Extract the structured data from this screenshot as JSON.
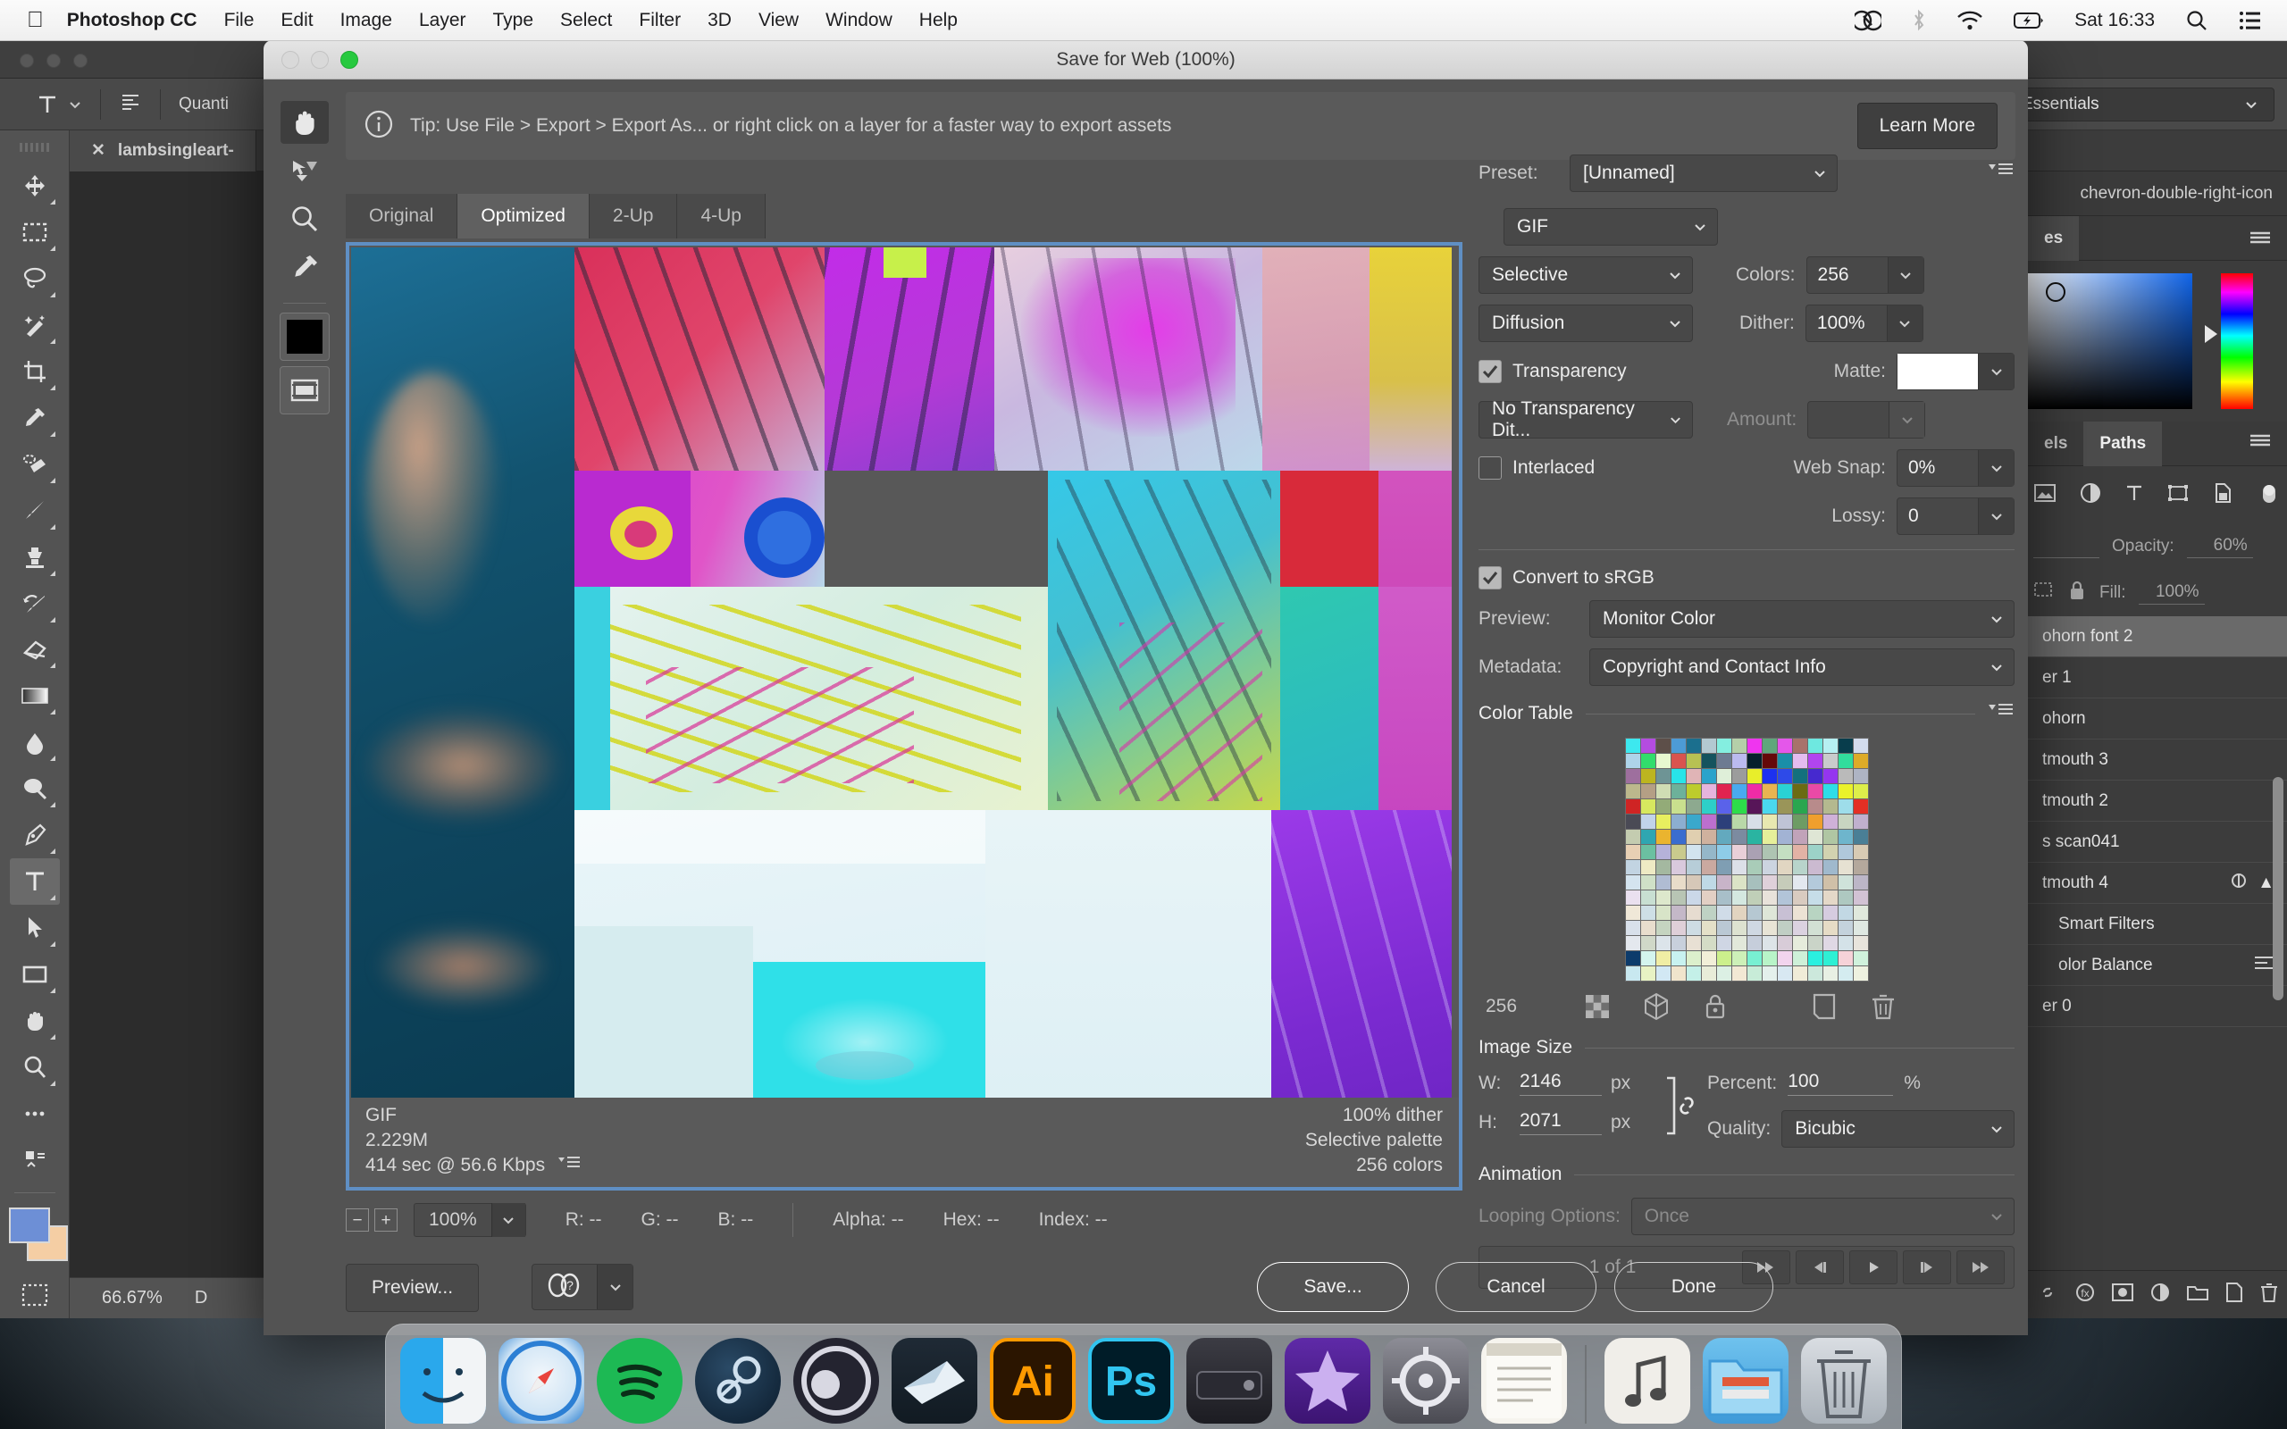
{
  "menubar": {
    "apple_icon": "apple-logo-icon",
    "app_name": "Photoshop CC",
    "items": [
      "File",
      "Edit",
      "Image",
      "Layer",
      "Type",
      "Select",
      "Filter",
      "3D",
      "View",
      "Window",
      "Help"
    ],
    "status_icons": [
      "creative-cloud-icon",
      "bluetooth-icon",
      "wifi-icon",
      "battery-charging-icon"
    ],
    "clock": "Sat 16:33",
    "search_icon": "search-icon",
    "control-center_icon": "control-center-icon"
  },
  "photoshop": {
    "options_bar": {
      "tool_label": "T",
      "paragraph_icon": "paragraph-align-icon",
      "quantity_label": "Quanti"
    },
    "workspace_select": "Essentials",
    "document_tab": {
      "name": "lambsingleart-",
      "close_icon": "close-icon"
    },
    "status_zoom": "66.67%",
    "status_doc": "D",
    "panel_tabs_top": [
      "es"
    ],
    "panel_tabs_mid": [
      "els",
      "Paths"
    ],
    "collapse_icon": "chevron-double-right-icon",
    "layer_opacity_label": "Opacity:",
    "layer_opacity_value": "60%",
    "layer_fill_label": "Fill:",
    "layer_fill_value": "100%",
    "layers": [
      {
        "name": "ohorn font 2",
        "selected": true
      },
      {
        "name": "er 1",
        "selected": false
      },
      {
        "name": "ohorn",
        "selected": false
      },
      {
        "name": "tmouth 3",
        "selected": false
      },
      {
        "name": "tmouth 2",
        "selected": false
      },
      {
        "name": "s scan041",
        "selected": false
      },
      {
        "name": "tmouth 4",
        "selected": false
      },
      {
        "name": "Smart Filters",
        "selected": false
      },
      {
        "name": "olor Balance",
        "selected": false
      },
      {
        "name": "er 0",
        "selected": false
      }
    ],
    "tools": [
      "move-tool-icon",
      "marquee-tool-icon",
      "lasso-tool-icon",
      "magic-wand-tool-icon",
      "crop-tool-icon",
      "eyedropper-tool-icon",
      "healing-brush-tool-icon",
      "brush-tool-icon",
      "clone-stamp-tool-icon",
      "history-brush-tool-icon",
      "eraser-tool-icon",
      "gradient-tool-icon",
      "blur-tool-icon",
      "dodge-tool-icon",
      "pen-tool-icon",
      "type-tool-icon",
      "path-selection-tool-icon",
      "rectangle-tool-icon",
      "hand-tool-icon",
      "zoom-tool-icon",
      "more-tools-icon",
      "edit-toolbar-icon"
    ],
    "quick-mask_icon": "quick-mask-icon"
  },
  "dialog": {
    "title": "Save for Web (100%)",
    "window_buttons": [
      "close-button",
      "minimize-button",
      "zoom-button"
    ],
    "tip": {
      "info_icon": "info-circle-icon",
      "text": "Tip: Use File > Export > Export As...  or right click on a layer for a faster way to export assets",
      "learn_more": "Learn More"
    },
    "tools": [
      {
        "name": "hand-tool-icon",
        "selected": true
      },
      {
        "name": "slice-select-tool-icon",
        "selected": false
      },
      {
        "name": "zoom-tool-icon",
        "selected": false
      },
      {
        "name": "eyedropper-tool-icon",
        "selected": false
      }
    ],
    "foreground_color": "#000000",
    "toggle_slices_icon": "toggle-slices-visibility-icon",
    "view_tabs": [
      {
        "label": "Original",
        "active": false
      },
      {
        "label": "Optimized",
        "active": true
      },
      {
        "label": "2-Up",
        "active": false
      },
      {
        "label": "4-Up",
        "active": false
      }
    ],
    "preview_info": {
      "format": "GIF",
      "filesize": "2.229M",
      "download_time": "414 sec @ 56.6 Kbps",
      "menu_icon": "panel-menu-icon",
      "dither": "100% dither",
      "palette": "Selective palette",
      "colors": "256 colors"
    },
    "status_bar": {
      "zoom_out_icon": "zoom-out-icon",
      "zoom_in_icon": "zoom-in-icon",
      "zoom_value": "100%",
      "r_label": "R: --",
      "g_label": "G: --",
      "b_label": "B: --",
      "alpha_label": "Alpha: --",
      "hex_label": "Hex: --",
      "index_label": "Index: --"
    },
    "settings": {
      "preset_label": "Preset:",
      "preset_value": "[Unnamed]",
      "preset_menu_icon": "panel-menu-icon",
      "format_value": "GIF",
      "palette_value": "Selective",
      "colors_label": "Colors:",
      "colors_value": "256",
      "dither_algo_value": "Diffusion",
      "dither_label": "Dither:",
      "dither_value": "100%",
      "transparency_label": "Transparency",
      "transparency_checked": true,
      "matte_label": "Matte:",
      "matte_color": "#ffffff",
      "transparency_dither_value": "No Transparency Dit...",
      "amount_label": "Amount:",
      "amount_value": "",
      "interlaced_label": "Interlaced",
      "interlaced_checked": false,
      "websnap_label": "Web Snap:",
      "websnap_value": "0%",
      "lossy_label": "Lossy:",
      "lossy_value": "0",
      "convert_srgb_label": "Convert to sRGB",
      "convert_srgb_checked": true,
      "preview_label": "Preview:",
      "preview_value": "Monitor Color",
      "metadata_label": "Metadata:",
      "metadata_value": "Copyright and Contact Info"
    },
    "color_table": {
      "heading": "Color Table",
      "menu_icon": "panel-menu-icon",
      "count": "256",
      "icons": [
        "transparency-swatch-icon",
        "web-safe-cube-icon",
        "lock-swatch-icon",
        "new-swatch-icon",
        "delete-swatch-icon"
      ],
      "swatches": [
        "#3de8ef",
        "#b44ce0",
        "#5d4f49",
        "#4d9bd6",
        "#1b6f8e",
        "#b3c9d1",
        "#84eee0",
        "#b5cfa9",
        "#ef35ef",
        "#60a77c",
        "#e457ea",
        "#a8726b",
        "#6ee8e0",
        "#b6f0f2",
        "#083d4c",
        "#d3dced",
        "#aed4ea",
        "#31dd6c",
        "#e8f8cf",
        "#d9534f",
        "#b7c153",
        "#14535e",
        "#6d7b92",
        "#bbbaef",
        "#06202c",
        "#650909",
        "#1a8fa8",
        "#e4bcef",
        "#b145ef",
        "#c9cbcc",
        "#31dd9c",
        "#ddab28",
        "#9e6f9e",
        "#bcb520",
        "#6e9495",
        "#28e4e8",
        "#e0b4b6",
        "#2aa3cb",
        "#dfefd9",
        "#9c9c9c",
        "#e8ee2a",
        "#1c31ef",
        "#2e4ae8",
        "#13707d",
        "#4629cf",
        "#9535ef",
        "#bababa",
        "#aeb4c4",
        "#bcb88c",
        "#b49f85",
        "#d0ddb4",
        "#6db19a",
        "#bdcc2c",
        "#e5b4dd",
        "#e02350",
        "#49aaef",
        "#ef2ba6",
        "#e8b451",
        "#2ad2d4",
        "#6b6b12",
        "#ea4aa6",
        "#2edde8",
        "#eaf22a",
        "#ddee4a",
        "#cf2424",
        "#d7e85f",
        "#93ab78",
        "#c9e08e",
        "#8da98f",
        "#2dcfc8",
        "#5a62ea",
        "#2ddc4a",
        "#571558",
        "#4ad8ee",
        "#9a9559",
        "#29a64f",
        "#b88b8b",
        "#b4b98f",
        "#9eddea",
        "#e42f24",
        "#4a4a55",
        "#c1d3ea",
        "#e8ef5f",
        "#8caed0",
        "#3aa8cc",
        "#bc6fce",
        "#2c3f7a",
        "#b9d8a8",
        "#d8dfe8",
        "#e8e8b0",
        "#bfc4d6",
        "#6d9c64",
        "#ef9f2d",
        "#cfb1d8",
        "#c8d5c1",
        "#c0b0ce",
        "#c4ccb0",
        "#2fa6b1",
        "#eab42f",
        "#3a6dcf",
        "#e0cfb0",
        "#cfb19e",
        "#63a9be",
        "#7c8ba0",
        "#2ab4a1",
        "#e6ef9a",
        "#a2b3d4",
        "#c1a3b9",
        "#dfe6d5",
        "#b0c6a3",
        "#6eb5cc",
        "#4a7f96",
        "#e8d0b4",
        "#6bc0a1",
        "#b5b2d9",
        "#c9ca8d",
        "#d2e4ef",
        "#95b7c9",
        "#8ecce8",
        "#e9cfd8",
        "#aaa1b3",
        "#aec4b2",
        "#c4dfc2",
        "#e2b2a5",
        "#9cd2c8",
        "#d2d2b0",
        "#b0c8db",
        "#d8cbb4",
        "#c2d4e2",
        "#eeeac4",
        "#a4b8a0",
        "#d9c9dd",
        "#b7cdd8",
        "#caa9a0",
        "#7f9eb3",
        "#dce0e8",
        "#a9ccb8",
        "#ccd4e0",
        "#e1d6c2",
        "#b8d4cb",
        "#cbbad0",
        "#a0b9cd",
        "#e6e1d2",
        "#b4a89c",
        "#d4e4ef",
        "#cfe0c7",
        "#b0bcd3",
        "#e8dcc9",
        "#d6c8b8",
        "#bfd9e6",
        "#c8b4c9",
        "#dbe3c6",
        "#a7c0bd",
        "#dfd0da",
        "#c6ccba",
        "#e3e8ef",
        "#b4cadb",
        "#d0c0a8",
        "#cfe2da",
        "#bcb6c7",
        "#eae0ef",
        "#c8dfd2",
        "#dde8cc",
        "#b8c5b4",
        "#cbd8e8",
        "#e2cfc4",
        "#a8bfc9",
        "#d4e8e0",
        "#c0cfb8",
        "#e8e2da",
        "#b2c4d8",
        "#d9cbc0",
        "#c6dde8",
        "#e4d8c8",
        "#aec8c0",
        "#d2c2d4",
        "#f0e8d8",
        "#cedfe6",
        "#d8e4c8",
        "#c4b8c8",
        "#e6dcd0",
        "#bfd2c4",
        "#d0dce8",
        "#e2d4c0",
        "#b6c8d2",
        "#dee6d8",
        "#c8c0d4",
        "#ece2d4",
        "#b8d4c2",
        "#d6cce0",
        "#c2d8e4",
        "#e0e8dc",
        "#d8e0ea",
        "#e8ddcd",
        "#c5d4c0",
        "#dfcfd8",
        "#cedce4",
        "#e4e0c8",
        "#bac8d4",
        "#dde2d0",
        "#cfd8e2",
        "#e8e4d6",
        "#c0cec4",
        "#dbd2e0",
        "#d2e0d4",
        "#e6dcc6",
        "#c4d2dc",
        "#dfe8e2",
        "#e4e8ee",
        "#d0d8c8",
        "#dce4ea",
        "#c8d0dc",
        "#e8e0d4",
        "#d4dcc6",
        "#cfd6e4",
        "#e2e8da",
        "#c6cedb",
        "#dde4e8",
        "#d8ccd8",
        "#e6ecdc",
        "#cad4c8",
        "#dfd8e4",
        "#d4e2e8",
        "#e8e4dc",
        "#0c3b6b",
        "#d4f4ee",
        "#f0eda4",
        "#c8f2f0",
        "#dcf0cc",
        "#f2efd8",
        "#ccf08c",
        "#cdf0b8",
        "#78f0d2",
        "#b8f4c8",
        "#f2d4ee",
        "#cef0d8",
        "#2af0e0",
        "#2ef0d4",
        "#f6d2d8",
        "#d0f2dc",
        "#c8e8f0",
        "#e8f2c4",
        "#d2e8f4",
        "#f0e4cc",
        "#c4f0e8",
        "#e8ecd8",
        "#dcf0e4",
        "#f2e8d4",
        "#c8ecd8",
        "#e4f0ec",
        "#d8e8f2",
        "#f0ecd8",
        "#cce8dc",
        "#e8f0e4",
        "#d4ecf0",
        "#eef2e0"
      ]
    },
    "image_size": {
      "heading": "Image Size",
      "w_label": "W:",
      "w_value": "2146",
      "w_unit": "px",
      "h_label": "H:",
      "h_value": "2071",
      "h_unit": "px",
      "link_icon": "chain-link-icon",
      "percent_label": "Percent:",
      "percent_value": "100",
      "percent_unit": "%",
      "quality_label": "Quality:",
      "quality_value": "Bicubic"
    },
    "animation": {
      "heading": "Animation",
      "looping_label": "Looping Options:",
      "looping_value": "Once",
      "frame_counter": "1 of 1",
      "controls": [
        "first-frame-icon",
        "previous-frame-icon",
        "play-icon",
        "next-frame-icon",
        "last-frame-icon"
      ]
    },
    "buttons": {
      "preview": "Preview...",
      "browser_icon": "browser-select-icon",
      "save": "Save...",
      "cancel": "Cancel",
      "done": "Done"
    }
  },
  "dock": {
    "apps": [
      {
        "name": "finder-icon",
        "running": true
      },
      {
        "name": "safari-icon",
        "running": true
      },
      {
        "name": "spotify-icon",
        "running": true
      },
      {
        "name": "steam-icon",
        "running": true
      },
      {
        "name": "obs-icon",
        "running": true
      },
      {
        "name": "sketch-icon",
        "running": true
      },
      {
        "name": "illustrator-icon",
        "running": true
      },
      {
        "name": "photoshop-icon",
        "running": true
      },
      {
        "name": "capture-one-icon",
        "running": false
      },
      {
        "name": "purple-star-app-icon",
        "running": true
      },
      {
        "name": "system-preferences-icon",
        "running": true
      },
      {
        "name": "notes-icon",
        "running": false
      },
      {
        "name": "music-icon",
        "running": false
      },
      {
        "name": "downloads-folder-icon",
        "running": false
      },
      {
        "name": "trash-icon",
        "running": false
      }
    ]
  }
}
